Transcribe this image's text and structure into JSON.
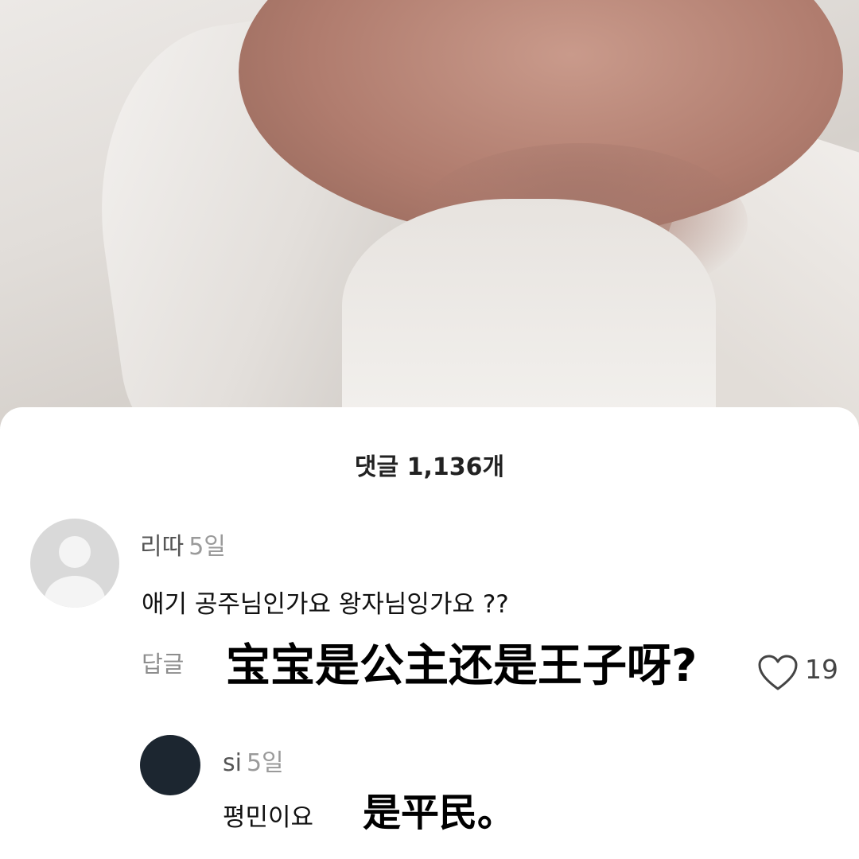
{
  "post": {
    "photo_alt": "baby photo"
  },
  "comments_sheet": {
    "title": "댓글 1,136개",
    "comments": [
      {
        "username": "리따",
        "time": "5일",
        "text": "애기 공주님인가요 왕자님잉가요 ??",
        "reply_label": "답글",
        "caption_overlay": "宝宝是公主还是王子呀?",
        "likes": "19",
        "avatar_icon": "default-avatar-icon"
      },
      {
        "username": "si",
        "time": "5일",
        "text": "평민이요",
        "caption_overlay": "是平民。",
        "avatar_icon": "dark-avatar-icon"
      }
    ]
  }
}
